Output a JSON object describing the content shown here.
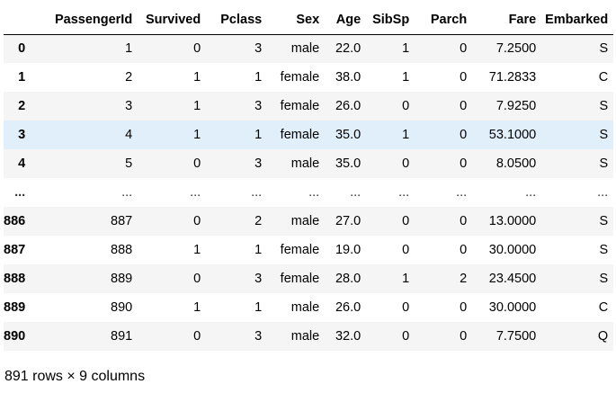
{
  "columns": [
    "PassengerId",
    "Survived",
    "Pclass",
    "Sex",
    "Age",
    "SibSp",
    "Parch",
    "Fare",
    "Embarked"
  ],
  "rows": [
    {
      "index": "0",
      "cells": [
        "1",
        "0",
        "3",
        "male",
        "22.0",
        "1",
        "0",
        "7.2500",
        "S"
      ]
    },
    {
      "index": "1",
      "cells": [
        "2",
        "1",
        "1",
        "female",
        "38.0",
        "1",
        "0",
        "71.2833",
        "C"
      ]
    },
    {
      "index": "2",
      "cells": [
        "3",
        "1",
        "3",
        "female",
        "26.0",
        "0",
        "0",
        "7.9250",
        "S"
      ]
    },
    {
      "index": "3",
      "cells": [
        "4",
        "1",
        "1",
        "female",
        "35.0",
        "1",
        "0",
        "53.1000",
        "S"
      ],
      "highlighted": true
    },
    {
      "index": "4",
      "cells": [
        "5",
        "0",
        "3",
        "male",
        "35.0",
        "0",
        "0",
        "8.0500",
        "S"
      ]
    },
    {
      "index": "...",
      "cells": [
        "...",
        "...",
        "...",
        "...",
        "...",
        "...",
        "...",
        "...",
        "..."
      ]
    },
    {
      "index": "886",
      "cells": [
        "887",
        "0",
        "2",
        "male",
        "27.0",
        "0",
        "0",
        "13.0000",
        "S"
      ]
    },
    {
      "index": "887",
      "cells": [
        "888",
        "1",
        "1",
        "female",
        "19.0",
        "0",
        "0",
        "30.0000",
        "S"
      ]
    },
    {
      "index": "888",
      "cells": [
        "889",
        "0",
        "3",
        "female",
        "28.0",
        "1",
        "2",
        "23.4500",
        "S"
      ]
    },
    {
      "index": "889",
      "cells": [
        "890",
        "1",
        "1",
        "male",
        "26.0",
        "0",
        "0",
        "30.0000",
        "C"
      ]
    },
    {
      "index": "890",
      "cells": [
        "891",
        "0",
        "3",
        "male",
        "32.0",
        "0",
        "0",
        "7.7500",
        "Q"
      ]
    }
  ],
  "summary": "891 rows × 9 columns",
  "colors": {
    "row_stripe": "#f5f5f5",
    "row_hover": "#e1effa",
    "header_border": "#000000"
  }
}
